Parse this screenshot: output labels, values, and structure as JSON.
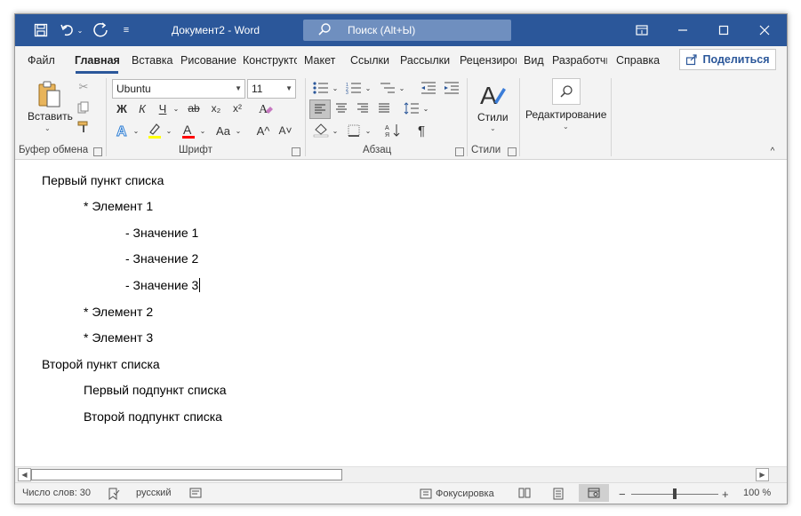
{
  "window": {
    "title": "Документ2  -  Word"
  },
  "search": {
    "placeholder": "Поиск (Alt+Ы)"
  },
  "tabs": [
    {
      "label": "Файл"
    },
    {
      "label": "Главная"
    },
    {
      "label": "Вставка"
    },
    {
      "label": "Рисование"
    },
    {
      "label": "Конструктор"
    },
    {
      "label": "Макет"
    },
    {
      "label": "Ссылки"
    },
    {
      "label": "Рассылки"
    },
    {
      "label": "Рецензирование"
    },
    {
      "label": "Вид"
    },
    {
      "label": "Разработчик"
    },
    {
      "label": "Справка"
    }
  ],
  "share_label": "Поделиться",
  "ribbon": {
    "clipboard": {
      "paste_label": "Вставить",
      "group_label": "Буфер обмена"
    },
    "font": {
      "name": "Ubuntu",
      "size": "11",
      "group_label": "Шрифт",
      "bold": "Ж",
      "italic": "К",
      "underline": "Ч",
      "strike": "ab",
      "subscript": "x₂",
      "superscript": "x²",
      "case": "Aa",
      "grow": "A^",
      "shrink": "A˅"
    },
    "paragraph": {
      "group_label": "Абзац"
    },
    "styles": {
      "label": "Стили",
      "group_label": "Стили"
    },
    "editing": {
      "label": "Редактирование"
    }
  },
  "document": {
    "lines": [
      "Первый пункт списка",
      "* Элемент 1",
      "- Значение 1",
      "- Значение 2",
      "- Значение 3",
      "* Элемент 2",
      "* Элемент 3",
      "Второй пункт списка",
      "Первый подпункт списка",
      "Второй подпункт списка"
    ]
  },
  "status": {
    "word_count": "Число слов: 30",
    "language": "русский",
    "focus": "Фокусировка",
    "zoom": "100 %"
  },
  "colors": {
    "titlebar": "#2b579a",
    "highlight": "#ffff00",
    "font_color": "#ff0000"
  }
}
